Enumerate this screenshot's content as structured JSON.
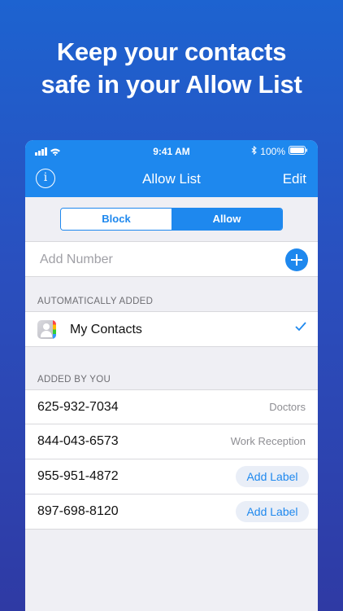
{
  "promo": {
    "line1": "Keep your contacts",
    "line2": "safe in your Allow List"
  },
  "status_bar": {
    "time": "9:41 AM",
    "battery": "100%"
  },
  "nav": {
    "title": "Allow List",
    "edit": "Edit",
    "info_icon": "info-icon"
  },
  "segments": {
    "block": "Block",
    "allow": "Allow",
    "selected": "Allow"
  },
  "add_number": {
    "placeholder": "Add Number"
  },
  "auto_section": {
    "header": "AUTOMATICALLY ADDED",
    "items": [
      {
        "name": "My Contacts",
        "checked": true
      }
    ]
  },
  "user_section": {
    "header": "ADDED BY YOU",
    "items": [
      {
        "number": "625-932-7034",
        "label": "Doctors"
      },
      {
        "number": "844-043-6573",
        "label": "Work Reception"
      },
      {
        "number": "955-951-4872",
        "button": "Add Label"
      },
      {
        "number": "897-698-8120",
        "button": "Add Label"
      }
    ]
  },
  "colors": {
    "accent": "#1e88ee",
    "background_top": "#1d63d0",
    "background_bottom": "#2f3aa4"
  }
}
